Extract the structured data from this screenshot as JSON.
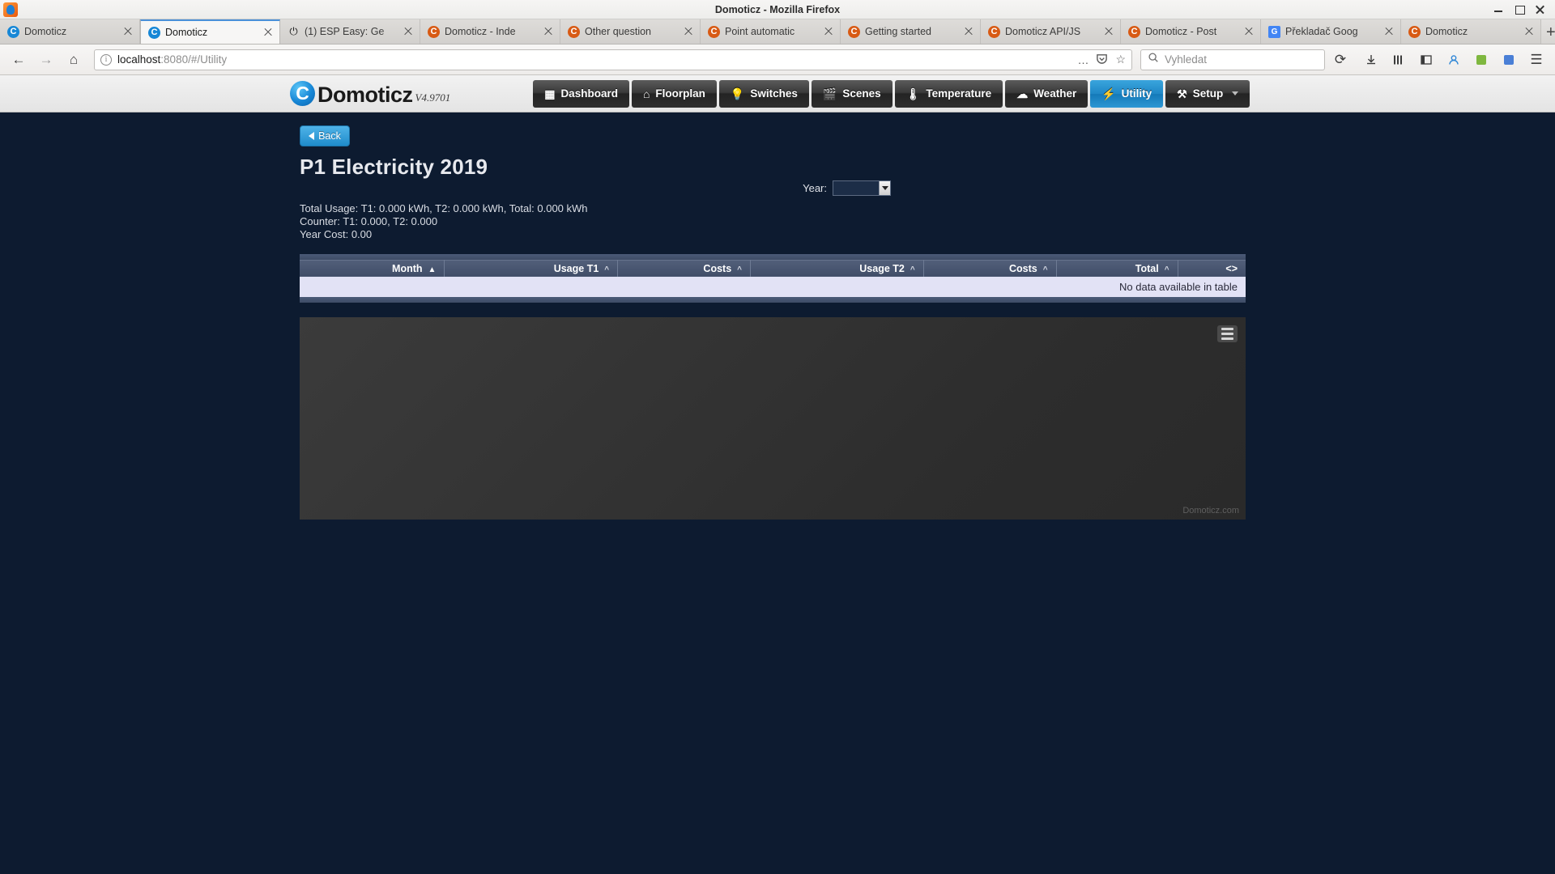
{
  "window": {
    "title": "Domoticz - Mozilla Firefox",
    "app_icon": "firefox-icon",
    "minimize": "minimize-button",
    "maximize": "maximize-button",
    "close": "close-button"
  },
  "tabs": [
    {
      "label": "Domoticz",
      "favicon": "domoticz-blue-icon",
      "active": false
    },
    {
      "label": "Domoticz",
      "favicon": "domoticz-blue-icon",
      "active": true
    },
    {
      "label": "(1) ESP Easy: Ge",
      "favicon": "esp-easy-icon",
      "active": false
    },
    {
      "label": "Domoticz - Inde",
      "favicon": "domoticz-orange-icon",
      "active": false
    },
    {
      "label": "Other question",
      "favicon": "domoticz-orange-icon",
      "active": false
    },
    {
      "label": "Point automatic",
      "favicon": "domoticz-orange-icon",
      "active": false
    },
    {
      "label": "Getting started",
      "favicon": "domoticz-orange-icon",
      "active": false
    },
    {
      "label": "Domoticz API/JS",
      "favicon": "domoticz-orange-icon",
      "active": false
    },
    {
      "label": "Domoticz - Post",
      "favicon": "domoticz-orange-icon",
      "active": false
    },
    {
      "label": "Překladač Goog",
      "favicon": "google-translate-icon",
      "active": false
    },
    {
      "label": "Domoticz",
      "favicon": "domoticz-orange-icon",
      "active": false
    }
  ],
  "tabstrip": {
    "new_tab": "+",
    "list_all_tabs": "⌄"
  },
  "browser": {
    "back": "←",
    "forward": "→",
    "home": "⌂",
    "url_host": "localhost",
    "url_rest": ":8080/#/Utility",
    "page_actions": "…",
    "pocket": "save-to-pocket",
    "bookmark": "☆",
    "search_placeholder": "Vyhledat",
    "reload": "⟳",
    "downloads": "⤓",
    "library": "library",
    "sidebar": "sidebar",
    "account": "account",
    "addon": "addon",
    "screenshot": "screenshot",
    "menu": "☰"
  },
  "domoticz": {
    "logo_word": "Domoticz",
    "version": "V4.9701",
    "menu": [
      {
        "label": "Dashboard",
        "icon": "dashboard-icon",
        "active": false,
        "caret": false
      },
      {
        "label": "Floorplan",
        "icon": "floorplan-icon",
        "active": false,
        "caret": false
      },
      {
        "label": "Switches",
        "icon": "lightbulb-icon",
        "active": false,
        "caret": false
      },
      {
        "label": "Scenes",
        "icon": "scenes-icon",
        "active": false,
        "caret": false
      },
      {
        "label": "Temperature",
        "icon": "thermometer-icon",
        "active": false,
        "caret": false
      },
      {
        "label": "Weather",
        "icon": "cloud-rain-icon",
        "active": false,
        "caret": false
      },
      {
        "label": "Utility",
        "icon": "utility-icon",
        "active": true,
        "caret": false
      },
      {
        "label": "Setup",
        "icon": "tools-icon",
        "active": false,
        "caret": true
      }
    ]
  },
  "page": {
    "back_label": "Back",
    "title": "P1 Electricity 2019",
    "year_label": "Year:",
    "year_value": "",
    "summary": {
      "total_usage": "Total Usage: T1: 0.000 kWh, T2: 0.000 kWh, Total: 0.000 kWh",
      "counter": "Counter: T1: 0.000, T2: 0.000",
      "year_cost": "Year Cost: 0.00"
    },
    "table": {
      "columns": [
        {
          "label": "Month",
          "sort": "asc",
          "active": true
        },
        {
          "label": "Usage T1",
          "sort": "asc",
          "active": false
        },
        {
          "label": "Costs",
          "sort": "asc",
          "active": false
        },
        {
          "label": "Usage T2",
          "sort": "asc",
          "active": false
        },
        {
          "label": "Costs",
          "sort": "asc",
          "active": false
        },
        {
          "label": "Total",
          "sort": "asc",
          "active": false
        },
        {
          "label": "<>",
          "sort": "none",
          "active": false
        }
      ],
      "rows": [],
      "empty_message": "No data available in table"
    },
    "chart": {
      "menu_icon": "hamburger-menu-icon",
      "credit": "Domoticz.com"
    }
  },
  "chart_data": {
    "type": "bar",
    "title": "",
    "subtitle": "",
    "xlabel": "",
    "ylabel": "",
    "categories": [],
    "series": [],
    "values": [],
    "legend": [],
    "grid": false,
    "note": "Empty chart - no data for P1 Electricity 2019"
  },
  "colors": {
    "accent_blue": "#1f8ccb",
    "page_background": "#0d1b30",
    "table_header": "#485573",
    "table_row": "#e2e2f5",
    "chart_background": "#313131"
  }
}
